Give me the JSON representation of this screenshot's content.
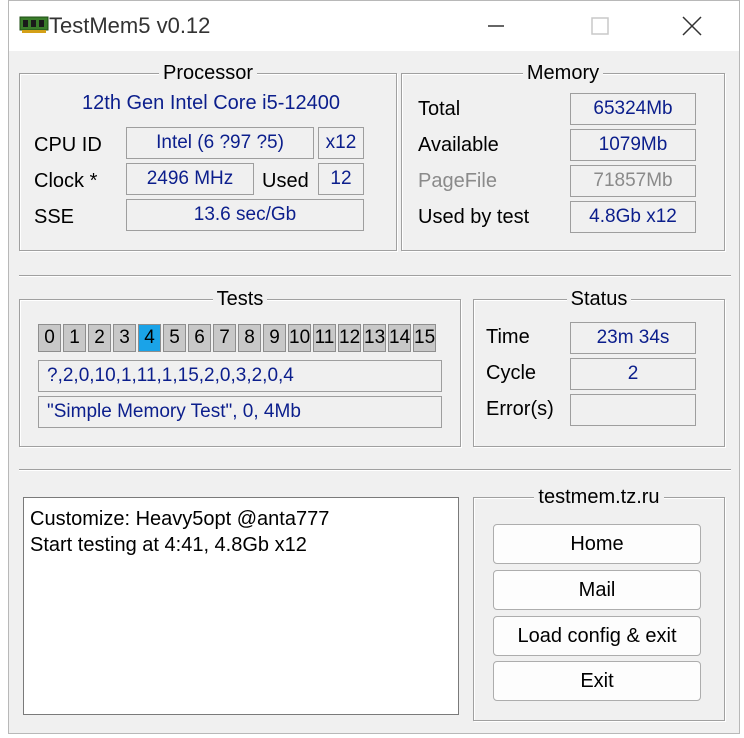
{
  "window": {
    "title": "TestMem5 v0.12"
  },
  "processor": {
    "title": "Processor",
    "name": "12th Gen Intel Core i5-12400",
    "cpu_id_label": "CPU ID",
    "cpu_id": "Intel  (6 ?97 ?5)",
    "threads": "x12",
    "clock_label": "Clock *",
    "clock": "2496 MHz",
    "used_label": "Used",
    "used": "12",
    "sse_label": "SSE",
    "sse": "13.6 sec/Gb"
  },
  "memory": {
    "title": "Memory",
    "total_label": "Total",
    "total": "65324Mb",
    "available_label": "Available",
    "available": "1079Mb",
    "pagefile_label": "PageFile",
    "pagefile": "71857Mb",
    "used_by_test_label": "Used by test",
    "used_by_test": "4.8Gb x12"
  },
  "tests": {
    "title": "Tests",
    "numbers": [
      "0",
      "1",
      "2",
      "3",
      "4",
      "5",
      "6",
      "7",
      "8",
      "9",
      "10",
      "11",
      "12",
      "13",
      "14",
      "15"
    ],
    "active_index": 4,
    "sequence": "?,2,0,10,1,11,1,15,2,0,3,2,0,4",
    "current": "\"Simple Memory Test\", 0, 4Mb"
  },
  "status": {
    "title": "Status",
    "time_label": "Time",
    "time": "23m 34s",
    "cycle_label": "Cycle",
    "cycle": "2",
    "errors_label": "Error(s)",
    "errors": ""
  },
  "log": {
    "lines": [
      "Customize: Heavy5opt @anta777",
      "Start testing at 4:41, 4.8Gb x12"
    ]
  },
  "links": {
    "title": "testmem.tz.ru",
    "home": "Home",
    "mail": "Mail",
    "load_config": "Load config & exit",
    "exit": "Exit"
  },
  "colors": {
    "value_text": "#0b1e8c",
    "active_test": "#1aa3e8",
    "window_bg": "#f0f0f0"
  }
}
